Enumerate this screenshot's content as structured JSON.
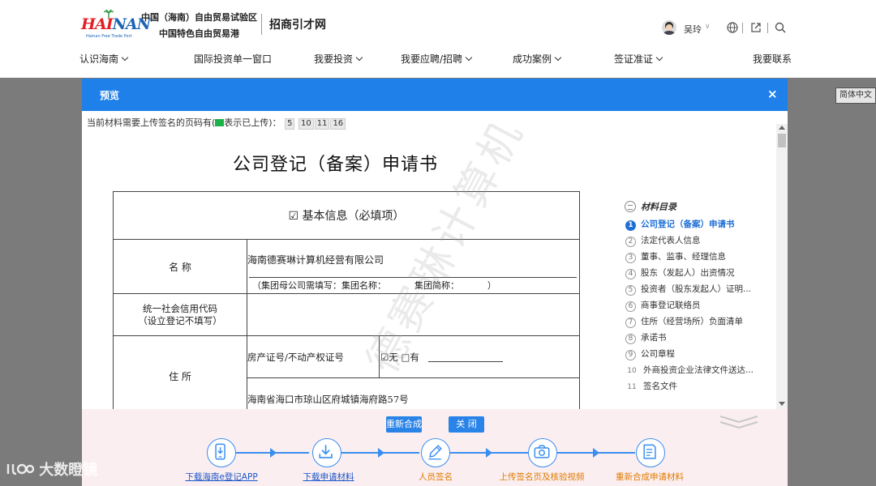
{
  "header": {
    "logo_text_red": "HAI",
    "logo_text_blue": "NAN",
    "logo_sub": "Hainan Free Trade Port",
    "org_line1": "中国（海南）自由贸易试验区",
    "org_line2": "中国特色自由贸易港",
    "site_name": "招商引才网",
    "user_name": "吴玲",
    "user_chevron": "∨"
  },
  "nav": [
    {
      "label": "认识海南",
      "has_dropdown": true
    },
    {
      "label": "国际投资单一窗口",
      "has_dropdown": false
    },
    {
      "label": "我要投资",
      "has_dropdown": true
    },
    {
      "label": "我要应聘/招聘",
      "has_dropdown": true
    },
    {
      "label": "成功案例",
      "has_dropdown": true
    },
    {
      "label": "签证准证",
      "has_dropdown": true
    },
    {
      "label": "我要联系",
      "has_dropdown": false
    }
  ],
  "language_button": "简体中文",
  "modal": {
    "title": "预览",
    "close": "×",
    "notice_prefix": "当前材料需要上传签名的页码有(",
    "notice_suffix": "表示已上传)：",
    "pages": [
      "5",
      "10",
      "11",
      "16"
    ],
    "uploaded_color": "#19b34a"
  },
  "document": {
    "title": "公司登记（备案）申请书",
    "section_header": "☑ 基本信息（必填项）",
    "name_label": "名    称",
    "company_name": "海南德赛琳计算机经营有限公司",
    "group_note": "（集团母公司需填写：集团名称：          集团简称：          ）",
    "credit_code_label_1": "统一社会信用代码",
    "credit_code_label_2": "（设立登记不填写）",
    "address_label": "住    所",
    "property_label": "房产证号/不动产权证号",
    "property_choice": "☑无  □有",
    "address_value": "海南省海口市琼山区府城镇海府路57号",
    "watermark": "德赛琳计算机"
  },
  "toc": {
    "title": "材料目录",
    "items": [
      {
        "num": "1",
        "label": "公司登记（备案）申请书",
        "active": true
      },
      {
        "num": "2",
        "label": "法定代表人信息",
        "active": false
      },
      {
        "num": "3",
        "label": "董事、监事、经理信息",
        "active": false
      },
      {
        "num": "4",
        "label": "股东（发起人）出资情况",
        "active": false
      },
      {
        "num": "5",
        "label": "投资者（股东发起人）证明...",
        "active": false
      },
      {
        "num": "6",
        "label": "商事登记联络员",
        "active": false
      },
      {
        "num": "7",
        "label": "住所（经营场所）负面清单",
        "active": false
      },
      {
        "num": "8",
        "label": "承诺书",
        "active": false
      },
      {
        "num": "9",
        "label": "公司章程",
        "active": false
      },
      {
        "num": "10",
        "label": "外商投资企业法律文件送达...",
        "active": false
      },
      {
        "num": "11",
        "label": "签名文件",
        "active": false
      }
    ]
  },
  "footer": {
    "regenerate_button": "重新合成",
    "close_button": "关 闭",
    "steps": [
      {
        "label": "下载海南e登记APP",
        "status": "link",
        "icon": "phone-download-icon"
      },
      {
        "label": "下载申请材料",
        "status": "link",
        "icon": "download-icon"
      },
      {
        "label": "人员签名",
        "status": "todo",
        "icon": "pen-sign-icon"
      },
      {
        "label": "上传签名页及核验视频",
        "status": "todo",
        "icon": "camera-icon"
      },
      {
        "label": "重新合成申请材料",
        "status": "todo",
        "icon": "document-edit-icon"
      }
    ],
    "accent": "#3a8ef0"
  },
  "brand_watermark": "大数瞪镜"
}
